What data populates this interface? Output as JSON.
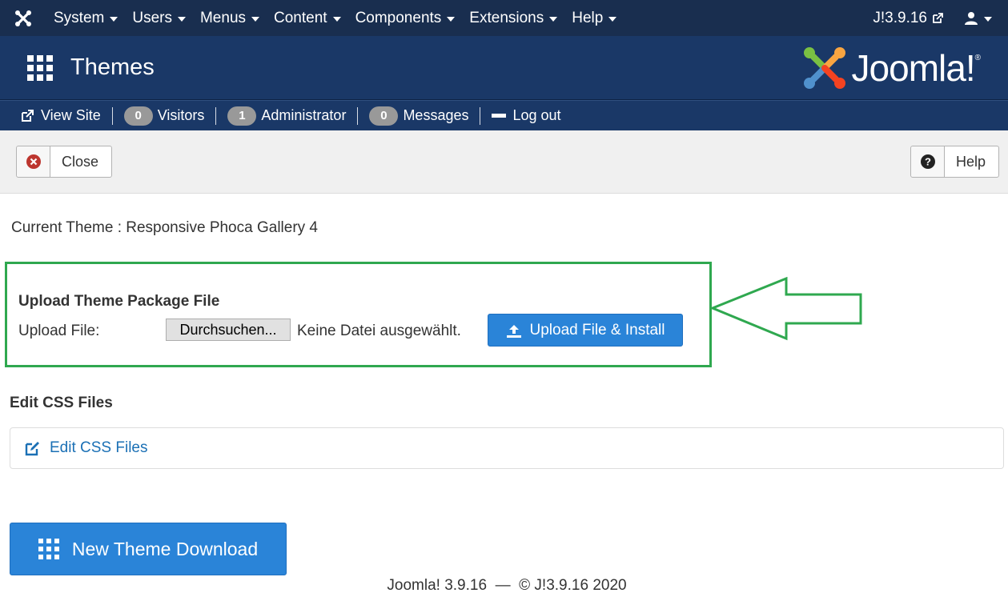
{
  "topnav": {
    "menu": [
      {
        "label": "System"
      },
      {
        "label": "Users"
      },
      {
        "label": "Menus"
      },
      {
        "label": "Content"
      },
      {
        "label": "Components"
      },
      {
        "label": "Extensions"
      },
      {
        "label": "Help"
      }
    ],
    "version_link": "J!3.9.16"
  },
  "header": {
    "title": "Themes",
    "logo_text": "Joomla!",
    "logo_reg": "®"
  },
  "statusbar": {
    "view_site": "View Site",
    "visitors_count": "0",
    "visitors_label": "Visitors",
    "admin_count": "1",
    "admin_label": "Administrator",
    "messages_count": "0",
    "messages_label": "Messages",
    "logout": "Log out"
  },
  "toolbar": {
    "close_label": "Close",
    "help_label": "Help"
  },
  "content": {
    "current_theme": "Current Theme : Responsive Phoca Gallery 4",
    "upload_title": "Upload Theme Package File",
    "upload_label": "Upload File:",
    "browse_label": "Durchsuchen...",
    "no_file_text": "Keine Datei ausgewählt.",
    "install_label": "Upload File & Install",
    "css_heading": "Edit CSS Files",
    "css_link": "Edit CSS Files",
    "new_theme_label": "New Theme Download"
  },
  "footer": {
    "text": "Joomla! 3.9.16  —  © J!3.9.16 2020"
  },
  "colors": {
    "nav_bg": "#192e4f",
    "header_bg": "#1a3867",
    "primary_btn": "#2a84d8",
    "highlight_green": "#2fa84f",
    "link": "#1b70b5"
  }
}
